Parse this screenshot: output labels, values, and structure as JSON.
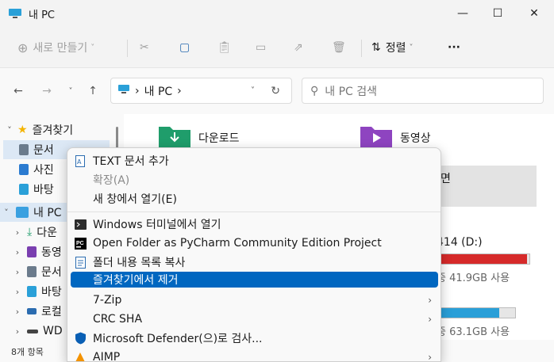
{
  "window": {
    "title": "내 PC"
  },
  "toolbar": {
    "new_label": "새로 만들기",
    "sort_label": "정렬",
    "more_label": "···"
  },
  "address": {
    "root_label": "내 PC"
  },
  "search": {
    "placeholder": "내 PC 검색"
  },
  "sidebar": {
    "items": [
      {
        "label": "즐겨찾기",
        "icon": "star-icon",
        "color": "#f4b400"
      },
      {
        "label": "문서",
        "icon": "documents-icon",
        "color": "#6b7b8c"
      },
      {
        "label": "사진",
        "icon": "pictures-icon",
        "color": "#2b7bd0"
      },
      {
        "label": "바탕",
        "icon": "desktop-icon",
        "color": "#2aa0d8"
      },
      {
        "label": "내 PC",
        "icon": "pc-icon",
        "color": "#3aa0e0"
      },
      {
        "label": "다운",
        "icon": "download-icon",
        "color": "#1f9d6b"
      },
      {
        "label": "동영",
        "icon": "videos-icon",
        "color": "#7a3fb0"
      },
      {
        "label": "문서",
        "icon": "documents-icon",
        "color": "#6b7b8c"
      },
      {
        "label": "바탕",
        "icon": "desktop-icon",
        "color": "#2aa0d8"
      },
      {
        "label": "로컬",
        "icon": "drive-icon",
        "color": "#2b6cb0"
      },
      {
        "label": "WD",
        "icon": "hdd-icon",
        "color": "#444444"
      }
    ]
  },
  "content": {
    "folders": [
      {
        "label": "다운로드",
        "icon": "download-folder-icon",
        "color": "#1f9d6b"
      },
      {
        "label": "동영상",
        "icon": "videos-folder-icon",
        "color": "#8e44c0"
      }
    ],
    "tile_partial_label": "면",
    "drives": [
      {
        "label": "414 (D:)",
        "free": "중 41.9GB 사용",
        "usage": 0.97,
        "color": "#d62a2a"
      },
      {
        "label": "",
        "free": "중 63.1GB 사용",
        "usage": 0.8,
        "color": "#2a9fd8"
      }
    ]
  },
  "status": {
    "count": "8개 항목"
  },
  "context_menu": {
    "items": [
      {
        "label": "TEXT 문서 추가",
        "icon": "text-doc-icon",
        "disabled": false
      },
      {
        "label": "확장(A)",
        "icon": "",
        "disabled": true
      },
      {
        "label": "새 창에서 열기(E)",
        "icon": "",
        "disabled": false
      },
      {
        "label": "Windows 터미널에서 열기",
        "icon": "terminal-icon",
        "disabled": false
      },
      {
        "label": "Open Folder as PyCharm Community Edition Project",
        "icon": "pycharm-icon",
        "disabled": false
      },
      {
        "label": "폴더 내용 목록 복사",
        "icon": "copy-list-icon",
        "disabled": false
      },
      {
        "label": "즐겨찾기에서 제거",
        "icon": "",
        "disabled": false,
        "highlighted": true
      },
      {
        "label": "7-Zip",
        "icon": "",
        "disabled": false,
        "submenu": true
      },
      {
        "label": "CRC SHA",
        "icon": "",
        "disabled": false,
        "submenu": true
      },
      {
        "label": "Microsoft Defender(으)로 검사...",
        "icon": "defender-icon",
        "disabled": false
      },
      {
        "label": "AIMP",
        "icon": "aimp-icon",
        "disabled": false,
        "submenu": true
      }
    ]
  }
}
